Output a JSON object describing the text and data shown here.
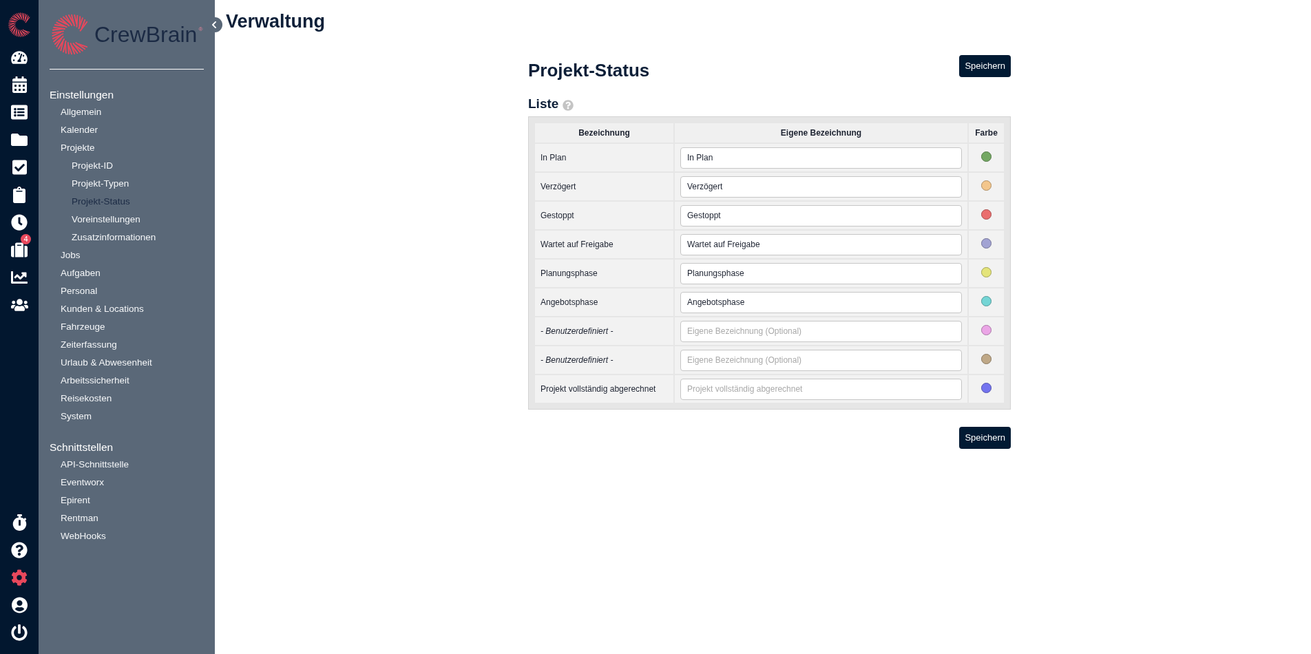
{
  "rail": {
    "items": [
      {
        "selected": false
      },
      {
        "selected": false
      },
      {
        "selected": false
      },
      {
        "selected": false
      },
      {
        "selected": false
      },
      {
        "selected": false
      },
      {
        "selected": false
      },
      {
        "selected": false,
        "badge": "4"
      },
      {
        "selected": false
      },
      {
        "selected": false
      }
    ],
    "bottom_items": [
      {
        "selected": false
      },
      {
        "selected": false
      },
      {
        "selected": true
      },
      {
        "selected": false
      },
      {
        "selected": false
      }
    ]
  },
  "sidebar": {
    "logo": {
      "text": "CrewBrain",
      "mark": "®"
    },
    "sections": [
      {
        "title": "Einstellungen",
        "items": [
          {
            "label": "Allgemein",
            "selected": false
          },
          {
            "label": "Kalender",
            "selected": false
          },
          {
            "label": "Projekte",
            "selected": false,
            "children": [
              {
                "label": "Projekt-ID",
                "selected": false
              },
              {
                "label": "Projekt-Typen",
                "selected": false
              },
              {
                "label": "Projekt-Status",
                "selected": true
              },
              {
                "label": "Voreinstellungen",
                "selected": false
              },
              {
                "label": "Zusatzinformationen",
                "selected": false
              }
            ]
          },
          {
            "label": "Jobs",
            "selected": false
          },
          {
            "label": "Aufgaben",
            "selected": false
          },
          {
            "label": "Personal",
            "selected": false
          },
          {
            "label": "Kunden & Locations",
            "selected": false
          },
          {
            "label": "Fahrzeuge",
            "selected": false
          },
          {
            "label": "Zeiterfassung",
            "selected": false
          },
          {
            "label": "Urlaub & Abwesenheit",
            "selected": false
          },
          {
            "label": "Arbeitssicherheit",
            "selected": false
          },
          {
            "label": "Reisekosten",
            "selected": false
          },
          {
            "label": "System",
            "selected": false
          }
        ]
      },
      {
        "title": "Schnittstellen",
        "items": [
          {
            "label": "API-Schnittstelle",
            "selected": false
          },
          {
            "label": "Eventworx",
            "selected": false
          },
          {
            "label": "Epirent",
            "selected": false
          },
          {
            "label": "Rentman",
            "selected": false
          },
          {
            "label": "WebHooks",
            "selected": false
          }
        ]
      }
    ]
  },
  "header": {
    "title": "Verwaltung"
  },
  "panel": {
    "title": "Projekt-Status",
    "top_button": "Speichern",
    "list": {
      "title": "Liste",
      "columns": [
        "Bezeichnung",
        "Eigene Bezeichnung",
        "Farbe"
      ],
      "rows": [
        {
          "name": "In Plan",
          "custom": false,
          "field": {
            "value": "In Plan"
          },
          "color": "#74a863"
        },
        {
          "name": "Verzögert",
          "custom": false,
          "field": {
            "value": "Verzögert"
          },
          "color": "#f3c68c"
        },
        {
          "name": "Gestoppt",
          "custom": false,
          "field": {
            "value": "Gestoppt"
          },
          "color": "#ea6e6e"
        },
        {
          "name": "Wartet auf Freigabe",
          "custom": false,
          "field": {
            "value": "Wartet auf Freigabe"
          },
          "color": "#a2a3d3"
        },
        {
          "name": "Planungsphase",
          "custom": false,
          "field": {
            "value": "Planungsphase"
          },
          "color": "#e4e47a"
        },
        {
          "name": "Angebotsphase",
          "custom": false,
          "field": {
            "value": "Angebotsphase"
          },
          "color": "#74d5d5"
        },
        {
          "name": "- Benutzerdefiniert -",
          "custom": true,
          "field": {
            "placeholder": "Eigene Bezeichnung (Optional)"
          },
          "color": "#eba5e6"
        },
        {
          "name": "- Benutzerdefiniert -",
          "custom": true,
          "field": {
            "placeholder": "Eigene Bezeichnung (Optional)"
          },
          "color": "#bfa887"
        },
        {
          "name": "Projekt vollständig abgerechnet",
          "custom": false,
          "field": {
            "placeholder": "Projekt vollständig abgerechnet"
          },
          "color": "#7373ef"
        }
      ]
    },
    "bottom_button": "Speichern"
  }
}
